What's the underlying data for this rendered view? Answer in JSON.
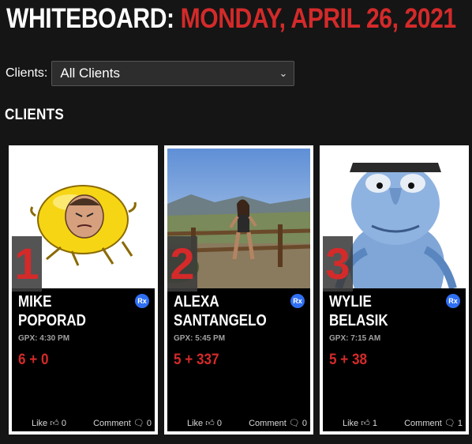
{
  "header": {
    "label": "WHITEBOARD:",
    "date": "MONDAY, APRIL 26, 2021"
  },
  "filter": {
    "label": "Clients:",
    "selected": "All Clients"
  },
  "section_title": "CLIENTS",
  "colors": {
    "accent_red": "#d42a2a",
    "rx_blue": "#2f6ff2",
    "background": "#151515"
  },
  "clients": [
    {
      "rank": "1",
      "first_name": "MIKE",
      "last_name": "POPORAD",
      "gpx": "GPX: 4:30 PM",
      "score": "6 + 0",
      "rx": "Rx",
      "like_label": "Like",
      "likes": "0",
      "comment_label": "Comment",
      "comments": "0"
    },
    {
      "rank": "2",
      "first_name": "ALEXA",
      "last_name": "SANTANGELO",
      "gpx": "GPX: 5:45 PM",
      "score": "5 + 337",
      "rx": "Rx",
      "like_label": "Like",
      "likes": "0",
      "comment_label": "Comment",
      "comments": "0"
    },
    {
      "rank": "3",
      "first_name": "WYLIE",
      "last_name": "BELASIK",
      "gpx": "GPX: 7:15 AM",
      "score": "5 + 38",
      "rx": "Rx",
      "like_label": "Like",
      "likes": "1",
      "comment_label": "Comment",
      "comments": "1"
    }
  ]
}
